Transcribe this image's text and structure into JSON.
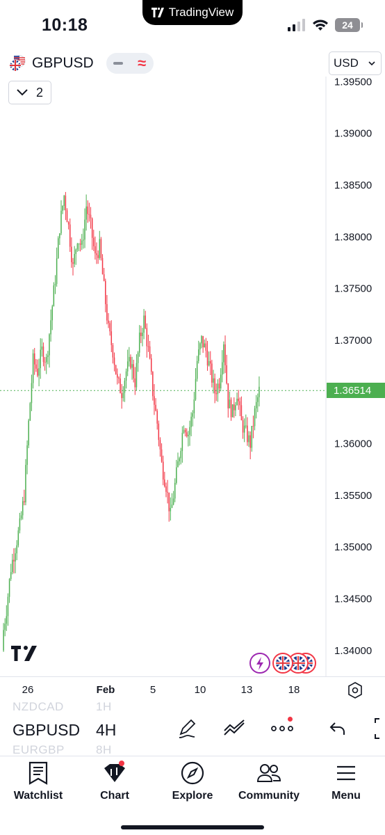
{
  "status_bar": {
    "time": "10:18",
    "notch_label": "TradingView",
    "battery": "24"
  },
  "header": {
    "symbol": "GBPUSD",
    "indicator_count": "2",
    "currency": "USD"
  },
  "colors": {
    "up": "#4caf50",
    "down": "#f23645",
    "accent": "#2962ff"
  },
  "chart_data": {
    "type": "candlestick",
    "y_ticks": [
      "1.39500",
      "1.39000",
      "1.38500",
      "1.38000",
      "1.37500",
      "1.37000",
      "1.36514",
      "1.36000",
      "1.35500",
      "1.35000",
      "1.34500",
      "1.34000"
    ],
    "y_tick_values": [
      1.395,
      1.39,
      1.385,
      1.38,
      1.375,
      1.37,
      1.36514,
      1.36,
      1.355,
      1.35,
      1.345,
      1.34
    ],
    "ylim": [
      1.3375,
      1.3955
    ],
    "last_price": 1.36514,
    "last_price_label": "1.36514",
    "x_ticks": [
      {
        "label": "26",
        "bold": false
      },
      {
        "label": "Feb",
        "bold": true
      },
      {
        "label": "5",
        "bold": false
      },
      {
        "label": "10",
        "bold": false
      },
      {
        "label": "13",
        "bold": false
      },
      {
        "label": "18",
        "bold": false
      }
    ],
    "x_tick_positions": [
      40,
      152,
      220,
      288,
      355,
      423
    ],
    "close_path": [
      1.341,
      1.344,
      1.348,
      1.35,
      1.352,
      1.355,
      1.362,
      1.368,
      1.367,
      1.369,
      1.368,
      1.372,
      1.376,
      1.381,
      1.384,
      1.381,
      1.377,
      1.38,
      1.379,
      1.383,
      1.381,
      1.378,
      1.379,
      1.375,
      1.371,
      1.369,
      1.366,
      1.365,
      1.367,
      1.368,
      1.366,
      1.37,
      1.372,
      1.369,
      1.365,
      1.362,
      1.358,
      1.356,
      1.353,
      1.356,
      1.359,
      1.362,
      1.361,
      1.363,
      1.368,
      1.37,
      1.369,
      1.367,
      1.365,
      1.366,
      1.37,
      1.364,
      1.363,
      1.365,
      1.362,
      1.361,
      1.36,
      1.363,
      1.3651
    ]
  },
  "pickers": {
    "symbol_prev": "NZDCAD",
    "symbol_current": "GBPUSD",
    "symbol_next": "EURGBP",
    "interval_prev": "1H",
    "interval_current": "4H",
    "interval_next": "8H"
  },
  "tabs": [
    {
      "label": "Watchlist"
    },
    {
      "label": "Chart"
    },
    {
      "label": "Explore"
    },
    {
      "label": "Community"
    },
    {
      "label": "Menu"
    }
  ]
}
